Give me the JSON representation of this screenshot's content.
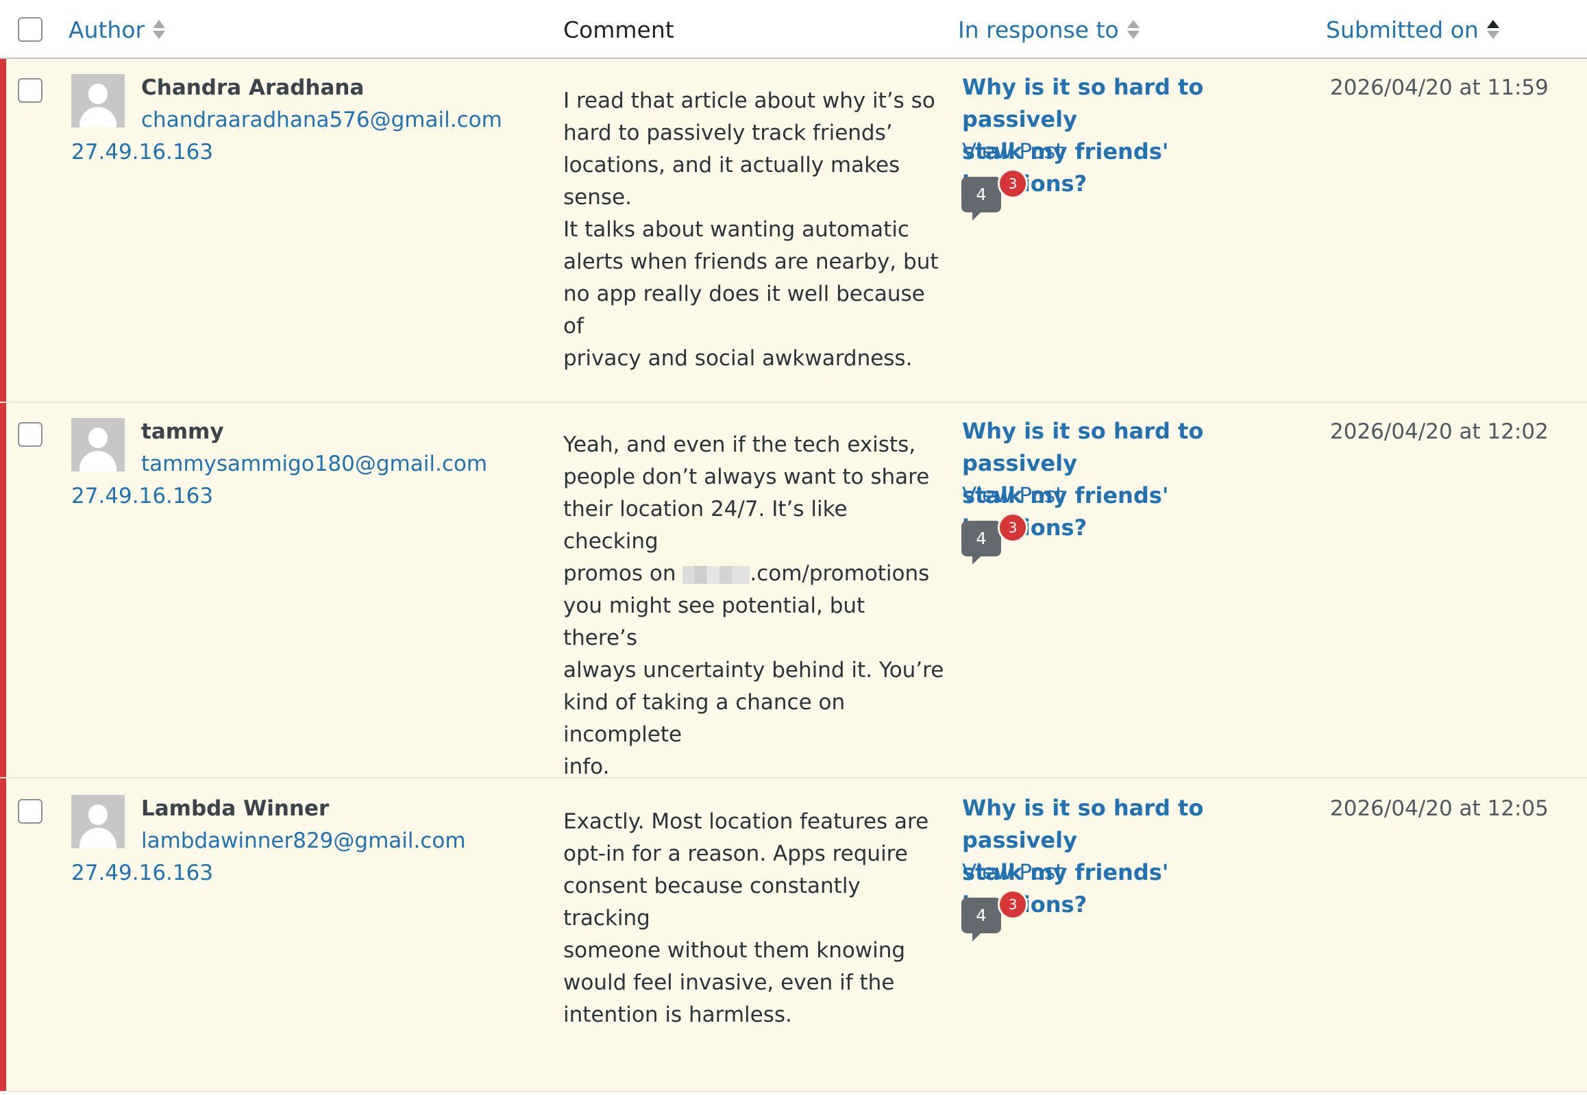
{
  "header": {
    "author_label": "Author",
    "comment_label": "Comment",
    "in_response_label": "In response to",
    "submitted_label": "Submitted on"
  },
  "comments": [
    {
      "author_name": "Chandra Aradhana",
      "author_email": "chandraaradhana576@gmail.com",
      "author_ip": "27.49.16.163",
      "lines": [
        "I read that article about why it’s so",
        "hard to passively track friends’",
        "locations, and it actually makes sense.",
        "It talks about wanting automatic",
        "alerts when friends are nearby, but",
        "no app really does it well because of",
        "privacy and social awkwardness."
      ],
      "post_title_line1": "Why is it so hard to passively",
      "post_title_line2": "stalk my friends' locations?",
      "view_post": "View Post",
      "comment_count": "4",
      "pending_count": "3",
      "submitted": "2026/04/20 at 11:59"
    },
    {
      "author_name": "tammy",
      "author_email": "tammysammigo180@gmail.com",
      "author_ip": "27.49.16.163",
      "lines": [
        "Yeah, and even if the tech exists,",
        "people don’t always want to share",
        "their location 24/7. It’s like checking",
        "promos on",
        ".com/promotions",
        "you might see potential, but there’s",
        "always uncertainty behind it. You’re",
        "kind of taking a chance on incomplete",
        "info."
      ],
      "post_title_line1": "Why is it so hard to passively",
      "post_title_line2": "stalk my friends' locations?",
      "view_post": "View Post",
      "comment_count": "4",
      "pending_count": "3",
      "submitted": "2026/04/20 at 12:02"
    },
    {
      "author_name": "Lambda Winner",
      "author_email": "lambdawinner829@gmail.com",
      "author_ip": "27.49.16.163",
      "lines": [
        "Exactly. Most location features are",
        "opt-in for a reason. Apps require",
        "consent because constantly tracking",
        "someone without them knowing",
        "would feel invasive, even if the",
        "intention is harmless."
      ],
      "post_title_line1": "Why is it so hard to passively",
      "post_title_line2": "stalk my friends' locations?",
      "view_post": "View Post",
      "comment_count": "4",
      "pending_count": "3",
      "submitted": "2026/04/20 at 12:05"
    }
  ],
  "colors": {
    "link": "#2271b1",
    "unapproved_row_bg": "#fcf9e8",
    "unapproved_border": "#d63638",
    "bubble": "#646970"
  }
}
